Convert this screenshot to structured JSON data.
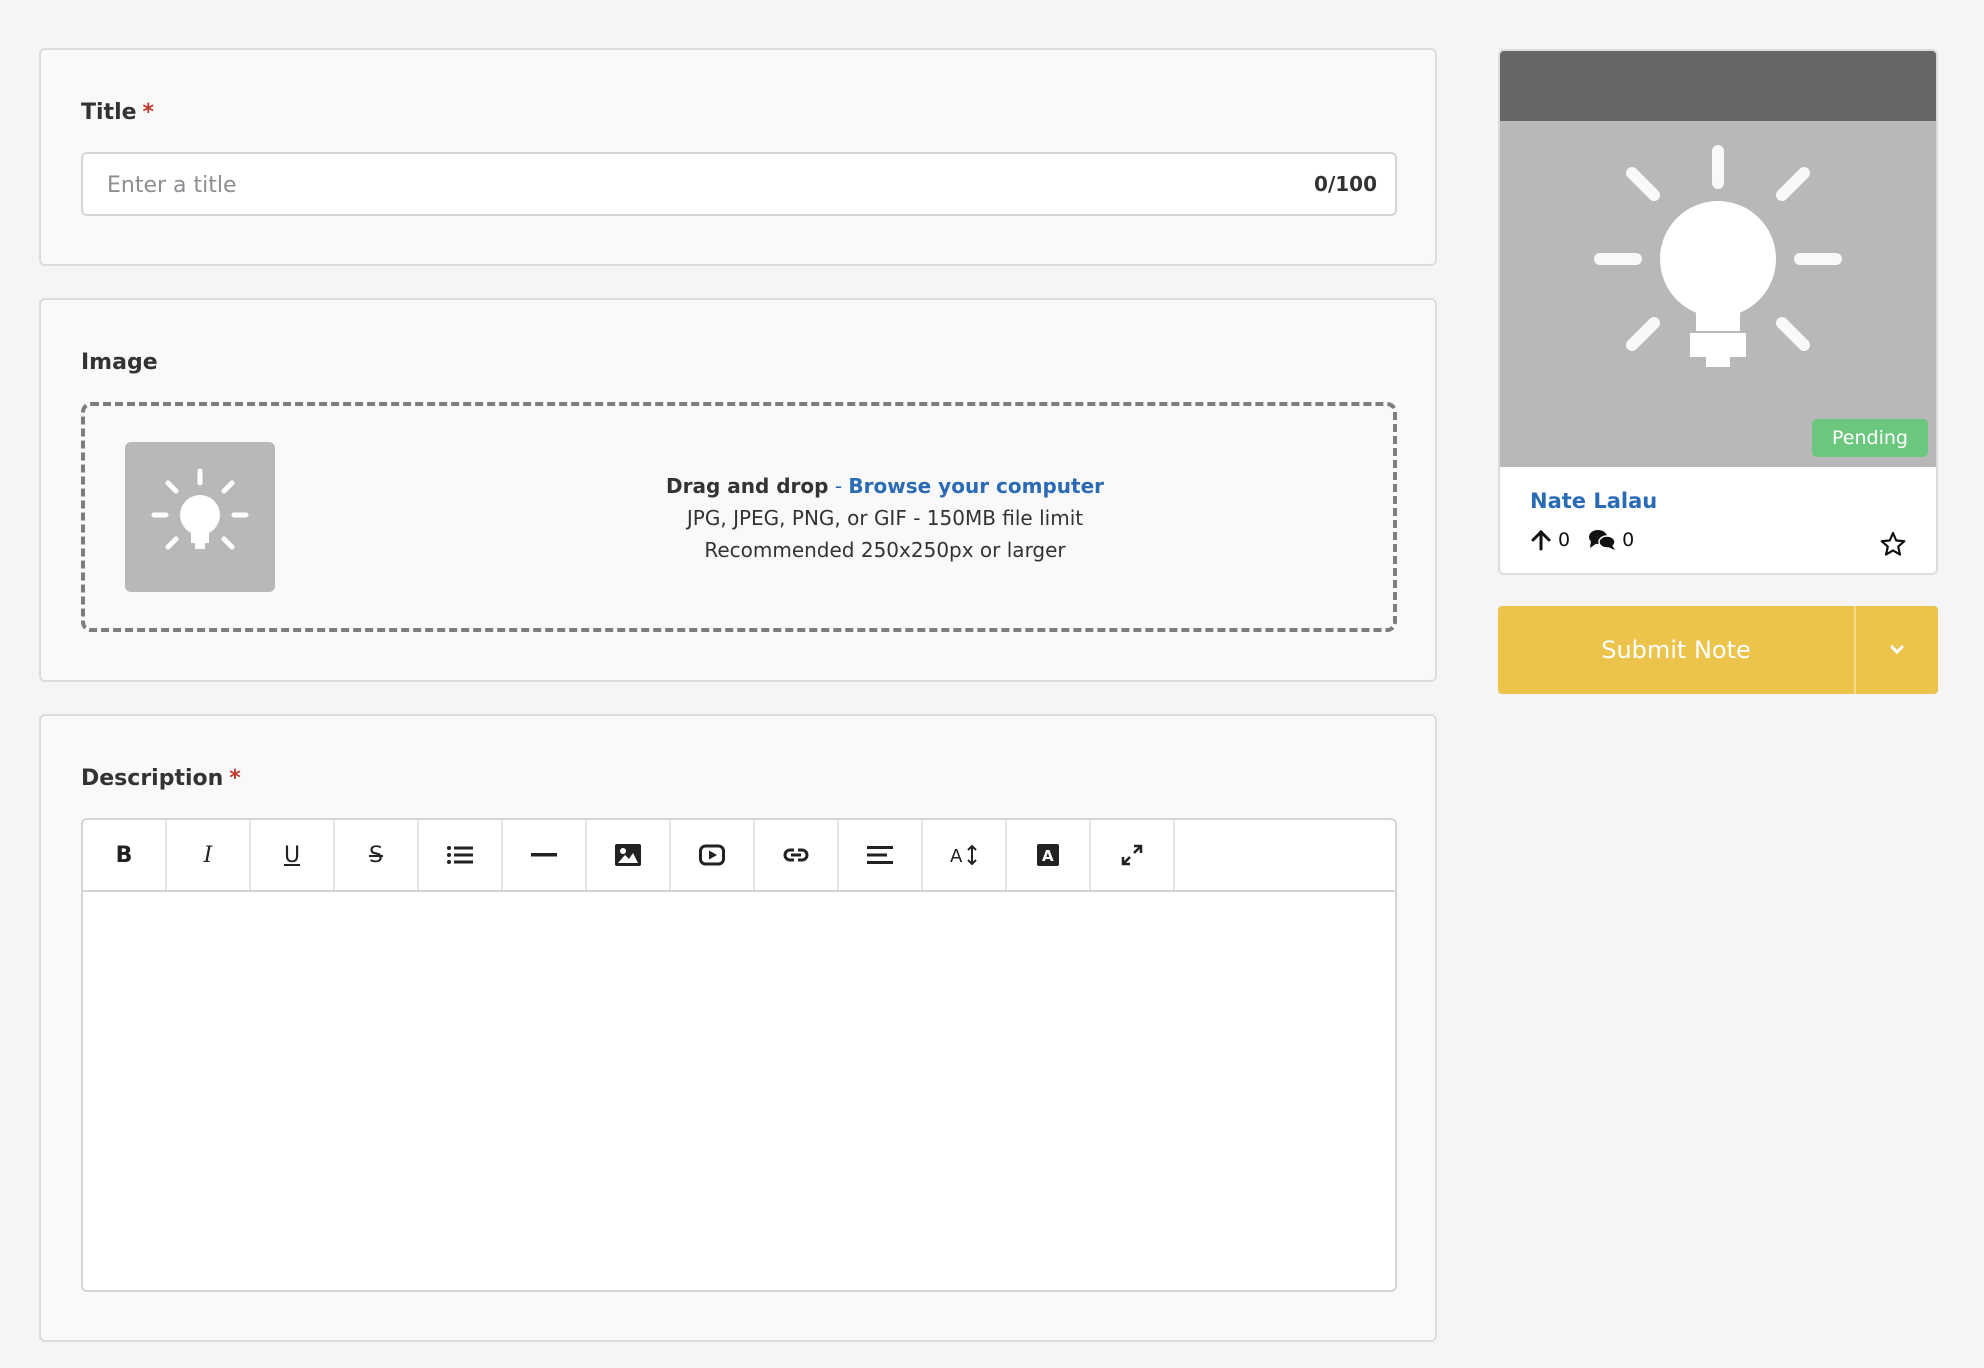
{
  "title_section": {
    "label": "Title",
    "required_mark": "*",
    "placeholder": "Enter a title",
    "counter": "0/100"
  },
  "image_section": {
    "label": "Image",
    "drag_text": "Drag and drop",
    "separator": " - ",
    "browse_link": "Browse your computer",
    "formats": "JPG, JPEG, PNG, or GIF - 150MB file limit",
    "recommendation": "Recommended 250x250px or larger"
  },
  "description_section": {
    "label": "Description",
    "required_mark": "*",
    "toolbar": [
      {
        "name": "bold-button",
        "glyph": "B"
      },
      {
        "name": "italic-button",
        "glyph": "I"
      },
      {
        "name": "underline-button",
        "glyph": "U"
      },
      {
        "name": "strikethrough-button",
        "glyph": "S"
      },
      {
        "name": "bullet-list-button",
        "glyph": "list-icon"
      },
      {
        "name": "horizontal-rule-button",
        "glyph": "rule-icon"
      },
      {
        "name": "insert-image-button",
        "glyph": "image-icon"
      },
      {
        "name": "insert-video-button",
        "glyph": "video-icon"
      },
      {
        "name": "insert-link-button",
        "glyph": "link-icon"
      },
      {
        "name": "align-button",
        "glyph": "align-icon"
      },
      {
        "name": "font-size-button",
        "glyph": "font-size-icon"
      },
      {
        "name": "text-color-button",
        "glyph": "text-color-icon"
      },
      {
        "name": "fullscreen-button",
        "glyph": "expand-icon"
      }
    ]
  },
  "preview_card": {
    "status": "Pending",
    "author": "Nate Lalau",
    "upvotes": "0",
    "comments": "0",
    "icons": [
      "lightbulb-icon",
      "upvote-icon",
      "comments-icon",
      "star-icon"
    ]
  },
  "actions": {
    "submit_label": "Submit Note",
    "dropdown_icon": "chevron-down-icon"
  },
  "colors": {
    "accent": "#ecc44c",
    "link": "#2a6bb3",
    "required": "#c0392b",
    "status_pending": "#6cc77e"
  }
}
